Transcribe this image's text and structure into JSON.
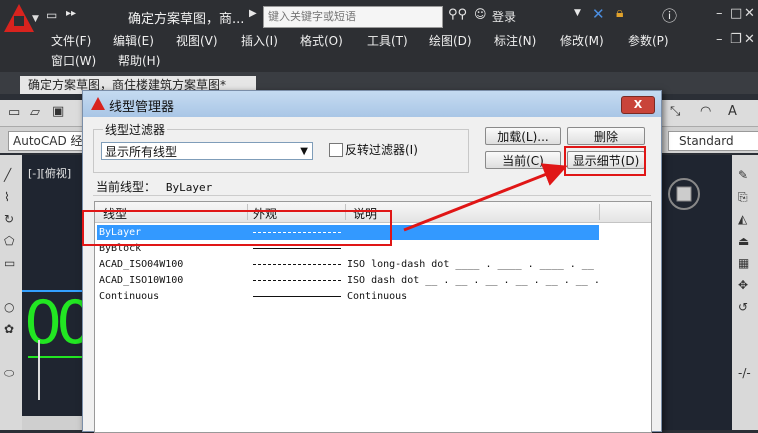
{
  "title_bar": {
    "doc_title": "确定方案草图，商...",
    "search_placeholder": "键入关键字或短语",
    "login_label": "登录",
    "qa_arrows": "▸▸"
  },
  "menu": {
    "row1": [
      "文件(F)",
      "编辑(E)",
      "视图(V)",
      "插入(I)",
      "格式(O)",
      "工具(T)",
      "绘图(D)",
      "标注(N)",
      "修改(M)",
      "参数(P)"
    ],
    "row2": [
      "窗口(W)",
      "帮助(H)"
    ]
  },
  "document_tab": "确定方案草图，商住楼建筑方案草图*",
  "toolbar": {
    "style_combo": "AutoCAD 经",
    "standard_combo": "Standard"
  },
  "canvas": {
    "view_label": "[-][俯视]",
    "big_text": "00"
  },
  "dialog": {
    "title": "线型管理器",
    "close_label": "X",
    "filter": {
      "group_label": "线型过滤器",
      "selected": "显示所有线型",
      "invert_label": "反转过滤器(I)"
    },
    "buttons": {
      "load": "加载(L)...",
      "delete": "删除",
      "current": "当前(C)",
      "details": "显示细节(D)"
    },
    "current_linetype_label": "当前线型：",
    "current_linetype_value": "ByLayer",
    "columns": [
      "线型",
      "外观",
      "说明"
    ],
    "rows": [
      {
        "name": "ByLayer",
        "appearance": "dash-dot",
        "description": "",
        "selected": true
      },
      {
        "name": "ByBlock",
        "appearance": "continuous",
        "description": "",
        "selected": false
      },
      {
        "name": "ACAD_ISO04W100",
        "appearance": "long-dash-dot",
        "description": "ISO long-dash dot ____ . ____ . ____ . __",
        "selected": false
      },
      {
        "name": "ACAD_ISO10W100",
        "appearance": "dash-dot",
        "description": "ISO dash dot __ . __ . __ . __ . __ . __ .",
        "selected": false
      },
      {
        "name": "Continuous",
        "appearance": "continuous",
        "description": "Continuous",
        "selected": false
      }
    ]
  },
  "colors": {
    "annotation_red": "#e01616",
    "selection_blue": "#3399ff",
    "canvas_green": "#22e622"
  }
}
